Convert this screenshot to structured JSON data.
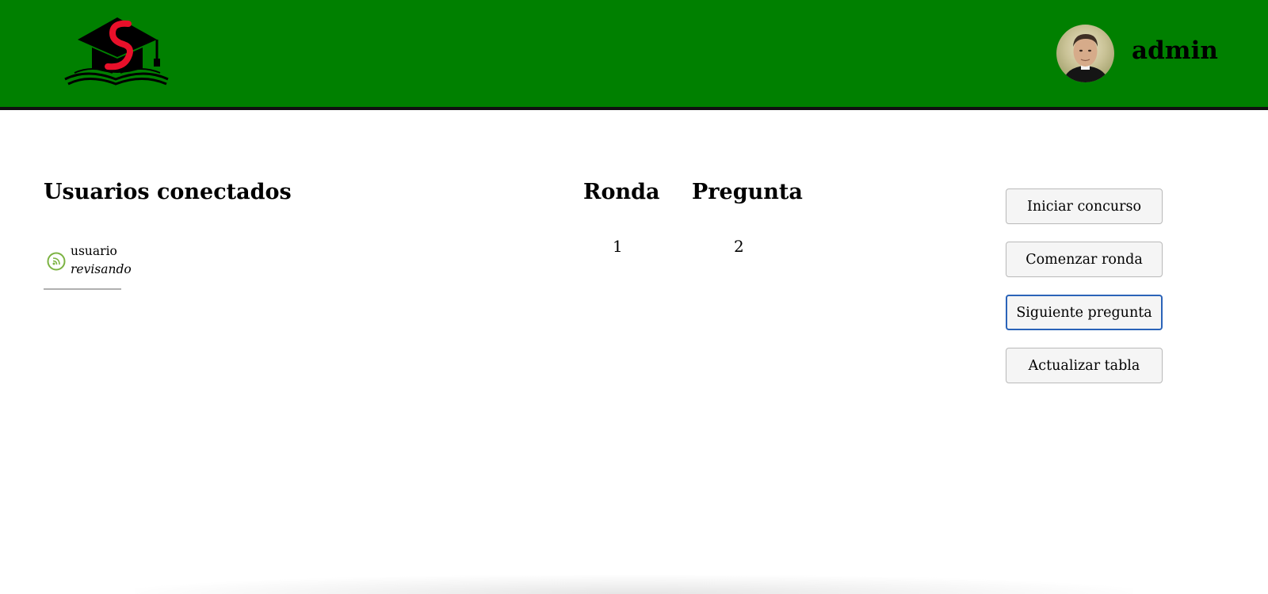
{
  "header": {
    "logo_icon": "graduation-cap-book-logo",
    "username": "admin",
    "bg_color": "#008000"
  },
  "users": {
    "title": "Usuarios conectados",
    "items": [
      {
        "name": "usuario",
        "status": "revisando",
        "status_icon": "connected-signal-icon",
        "status_color": "#7cb342"
      }
    ]
  },
  "ronda": {
    "label": "Ronda",
    "value": "1"
  },
  "pregunta": {
    "label": "Pregunta",
    "value": "2"
  },
  "actions": {
    "start_contest": "Iniciar concurso",
    "start_round": "Comenzar ronda",
    "next_question": "Siguiente pregunta",
    "update_table": "Actualizar tabla"
  }
}
